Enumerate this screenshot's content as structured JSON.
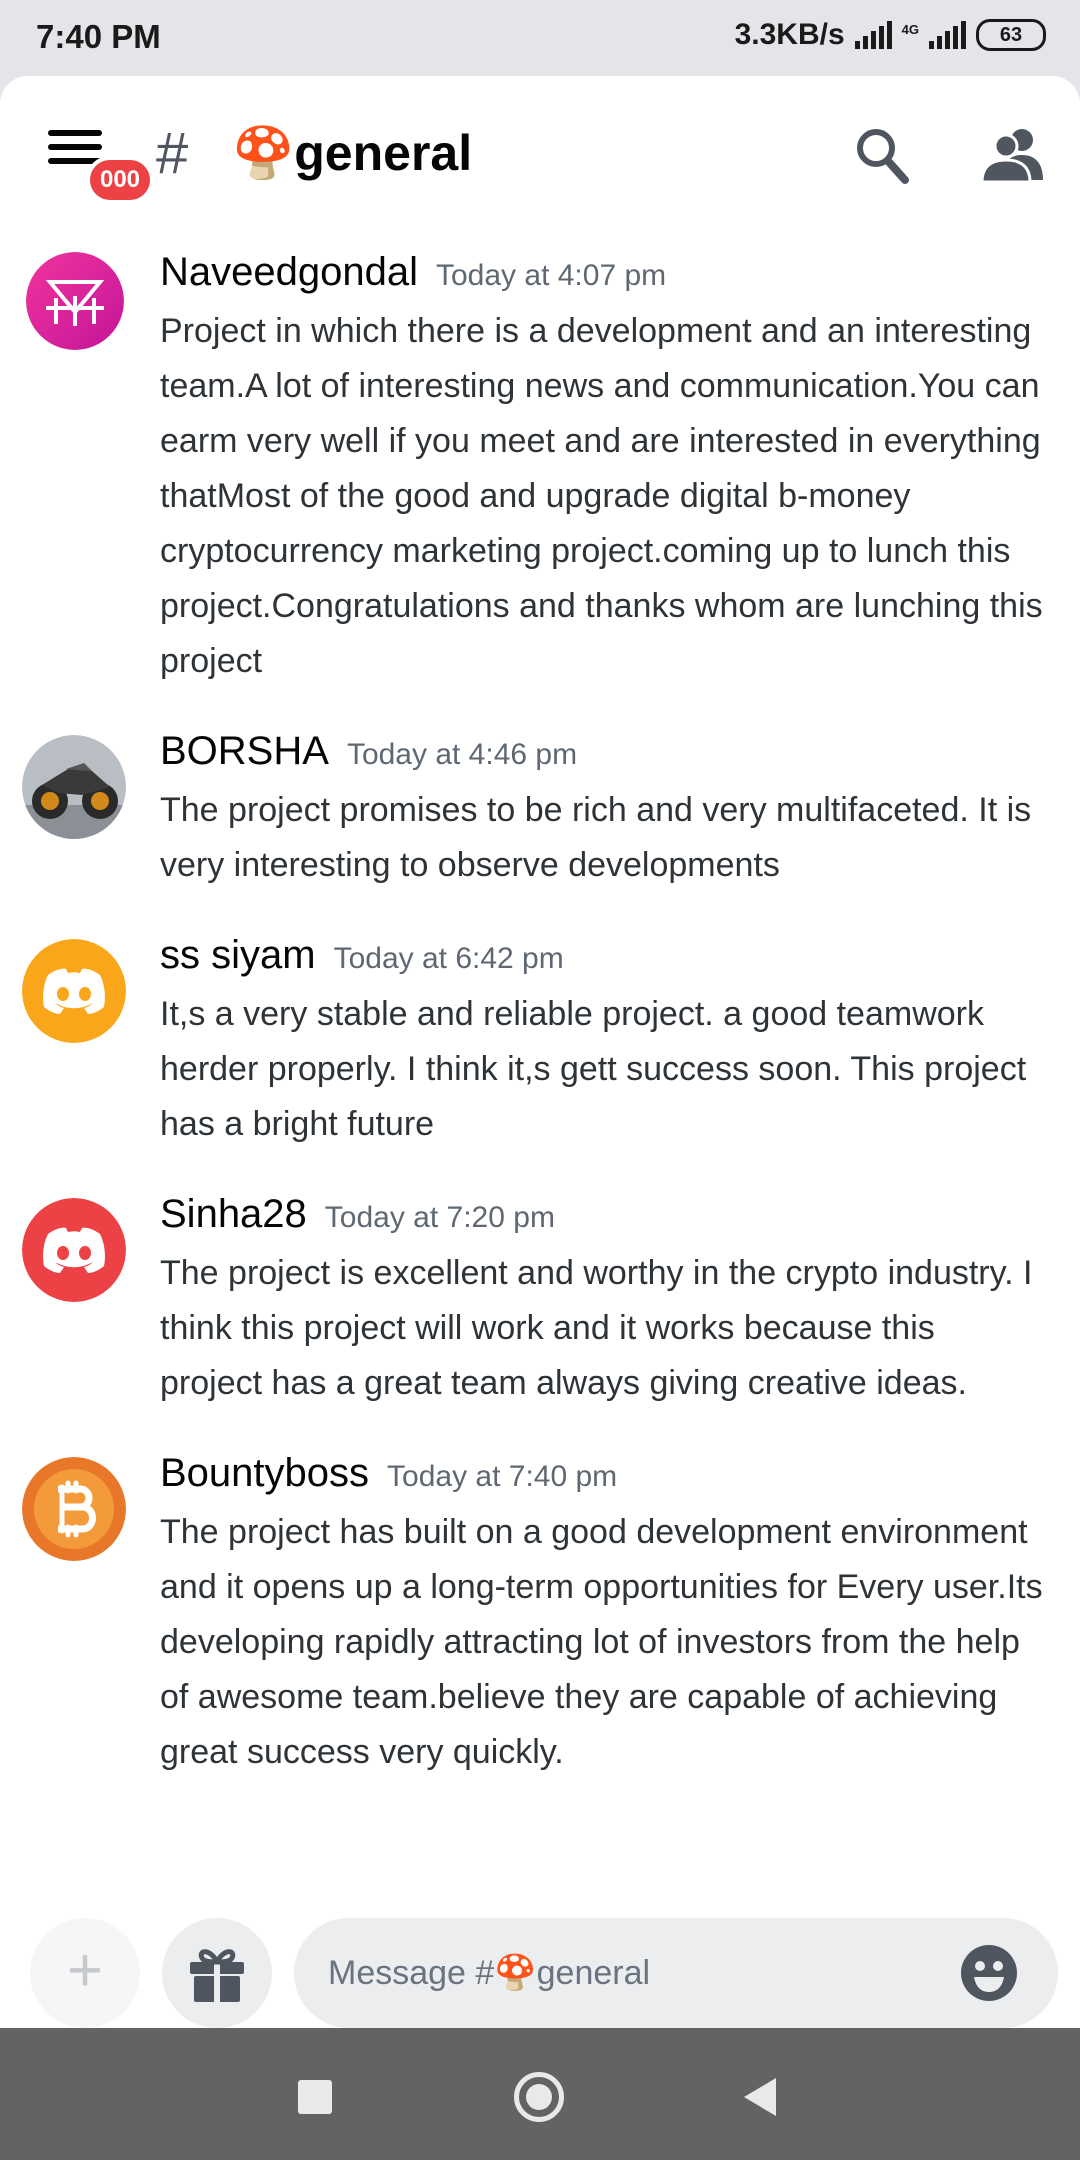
{
  "status_bar": {
    "time": "7:40 PM",
    "speed": "3.3KB/s",
    "network": "4G",
    "battery": "63"
  },
  "header": {
    "badge": "000",
    "channel_emoji": "🍄",
    "channel_name": "general"
  },
  "messages": [
    {
      "author": "Naveedgondal",
      "time": "Today at 4:07 pm",
      "text": "Project in which there is a development and an interesting team.A lot of interesting news and communication.You can earm very well if you meet and are interested in everything thatMost of the good and upgrade  digital b-money cryptocurrency marketing project.coming up to lunch this project.Congratulations and thanks whom are lunching this project"
    },
    {
      "author": "BORSHA",
      "time": "Today at 4:46 pm",
      "text": "The project promises to be rich and very multifaceted. It is very interesting to observe developments"
    },
    {
      "author": "ss siyam",
      "time": "Today at 6:42 pm",
      "text": "It,s a very stable and reliable project. a good teamwork herder properly. I think it,s gett success soon. This project has a bright future"
    },
    {
      "author": "Sinha28",
      "time": "Today at 7:20 pm",
      "text": "The project is excellent and worthy in the crypto industry. I think this project will work and it works because this project has a great team always giving creative ideas."
    },
    {
      "author": "Bountyboss",
      "time": "Today at 7:40 pm",
      "text": "The project has built on a good development environment and it opens up a long-term opportunities for Every user.Its developing rapidly attracting lot of investors from the help of awesome team.believe they are capable of achieving great success very quickly."
    }
  ],
  "composer": {
    "plus": "+",
    "placeholder": "Message #🍄general"
  },
  "colors": {
    "accent_red": "#ed4245",
    "discord_orange": "#faa61a",
    "bitcoin_orange": "#f7931a",
    "magenta": "#e91e8c"
  }
}
